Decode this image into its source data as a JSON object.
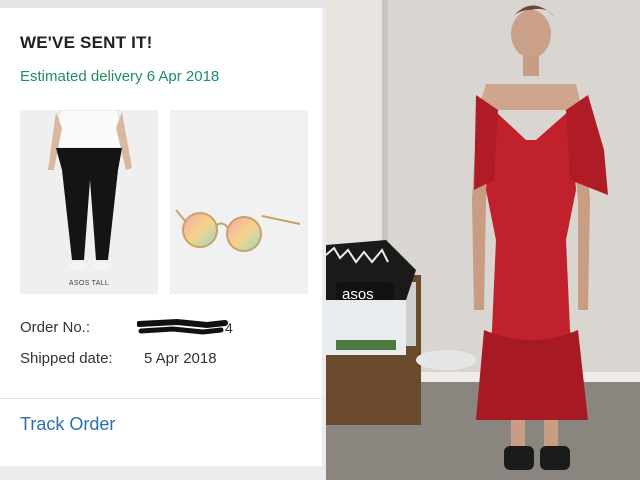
{
  "order_card": {
    "title": "WE'VE SENT IT!",
    "estimated_delivery": "Estimated delivery 6 Apr 2018",
    "items": [
      {
        "name": "jeans-product-image",
        "caption": "ASOS TALL"
      },
      {
        "name": "sunglasses-product-image"
      }
    ],
    "order_no_label": "Order No.:",
    "order_no_value_visible_suffix": "4",
    "shipped_label": "Shipped date:",
    "shipped_value": "5 Apr 2018",
    "track_order": "Track Order"
  },
  "photo": {
    "bag_logo": "asos"
  },
  "colors": {
    "accent_green": "#1f8f5d",
    "link_blue": "#2c6fae",
    "dress_red": "#c0212b"
  }
}
